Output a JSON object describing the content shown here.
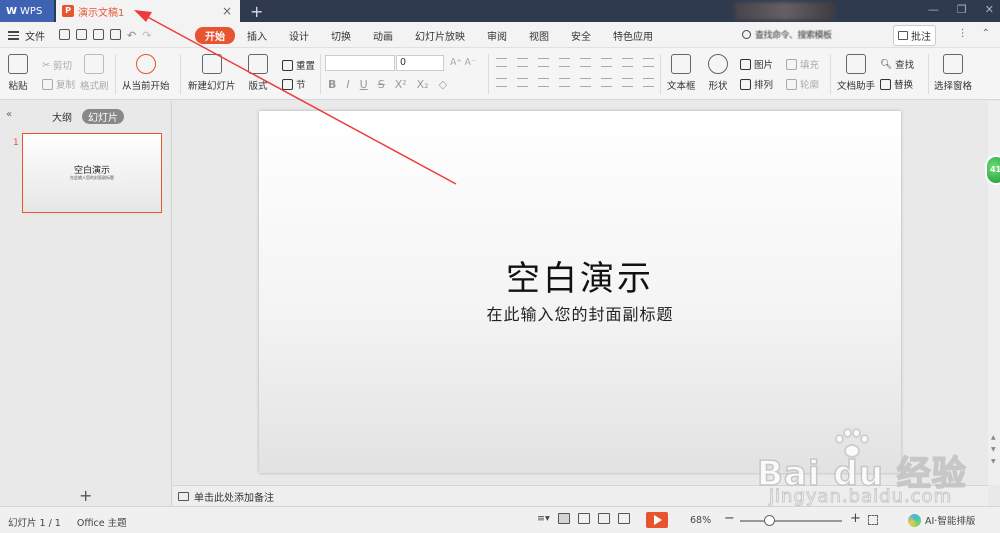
{
  "titlebar": {
    "app_tab": "WPS",
    "doc_tab": "演示文稿1",
    "add_tab": "+",
    "close": "×"
  },
  "menubar": {
    "file": "文件",
    "tabs": [
      "开始",
      "插入",
      "设计",
      "切换",
      "动画",
      "幻灯片放映",
      "审阅",
      "视图",
      "安全",
      "特色应用"
    ],
    "search_label": "查找命令、搜索模板",
    "comment": "批注"
  },
  "ribbon": {
    "paste": "粘贴",
    "cut": "剪切",
    "copy": "复制",
    "format_painter": "格式刷",
    "from_current": "从当前开始",
    "new_slide": "新建幻灯片",
    "layout": "版式",
    "reset": "重置",
    "section": "节",
    "font_size": "0",
    "text_box": "文本框",
    "shape": "形状",
    "picture": "图片",
    "fill": "填充",
    "arrange": "排列",
    "outline": "轮廓",
    "doc_helper": "文档助手",
    "find": "查找",
    "replace": "替换",
    "selection_pane": "选择窗格"
  },
  "leftpanel": {
    "tab_outline": "大纲",
    "tab_slides": "幻灯片",
    "slide_number": "1",
    "thumb_title": "空白演示",
    "thumb_subtitle": "在此输入您的封面副标题",
    "add_slide": "+"
  },
  "slide": {
    "title": "空白演示",
    "subtitle": "在此输入您的封面副标题"
  },
  "notes": {
    "placeholder": "单击此处添加备注"
  },
  "statusbar": {
    "slide_count": "幻灯片 1 / 1",
    "theme": "Office 主题",
    "zoom": "68%",
    "zoom_fraction": 0.28,
    "ai_layout": "AI·智能排版"
  },
  "badge": {
    "value": "41"
  },
  "watermark": {
    "brand": "Bai du 经验",
    "url": "jingyan.baidu.com"
  },
  "colors": {
    "accent": "#e8542f",
    "titlebar": "#2f3a4e",
    "wps_blue": "#3f63b3",
    "arrow_red": "#ee3b3b"
  }
}
